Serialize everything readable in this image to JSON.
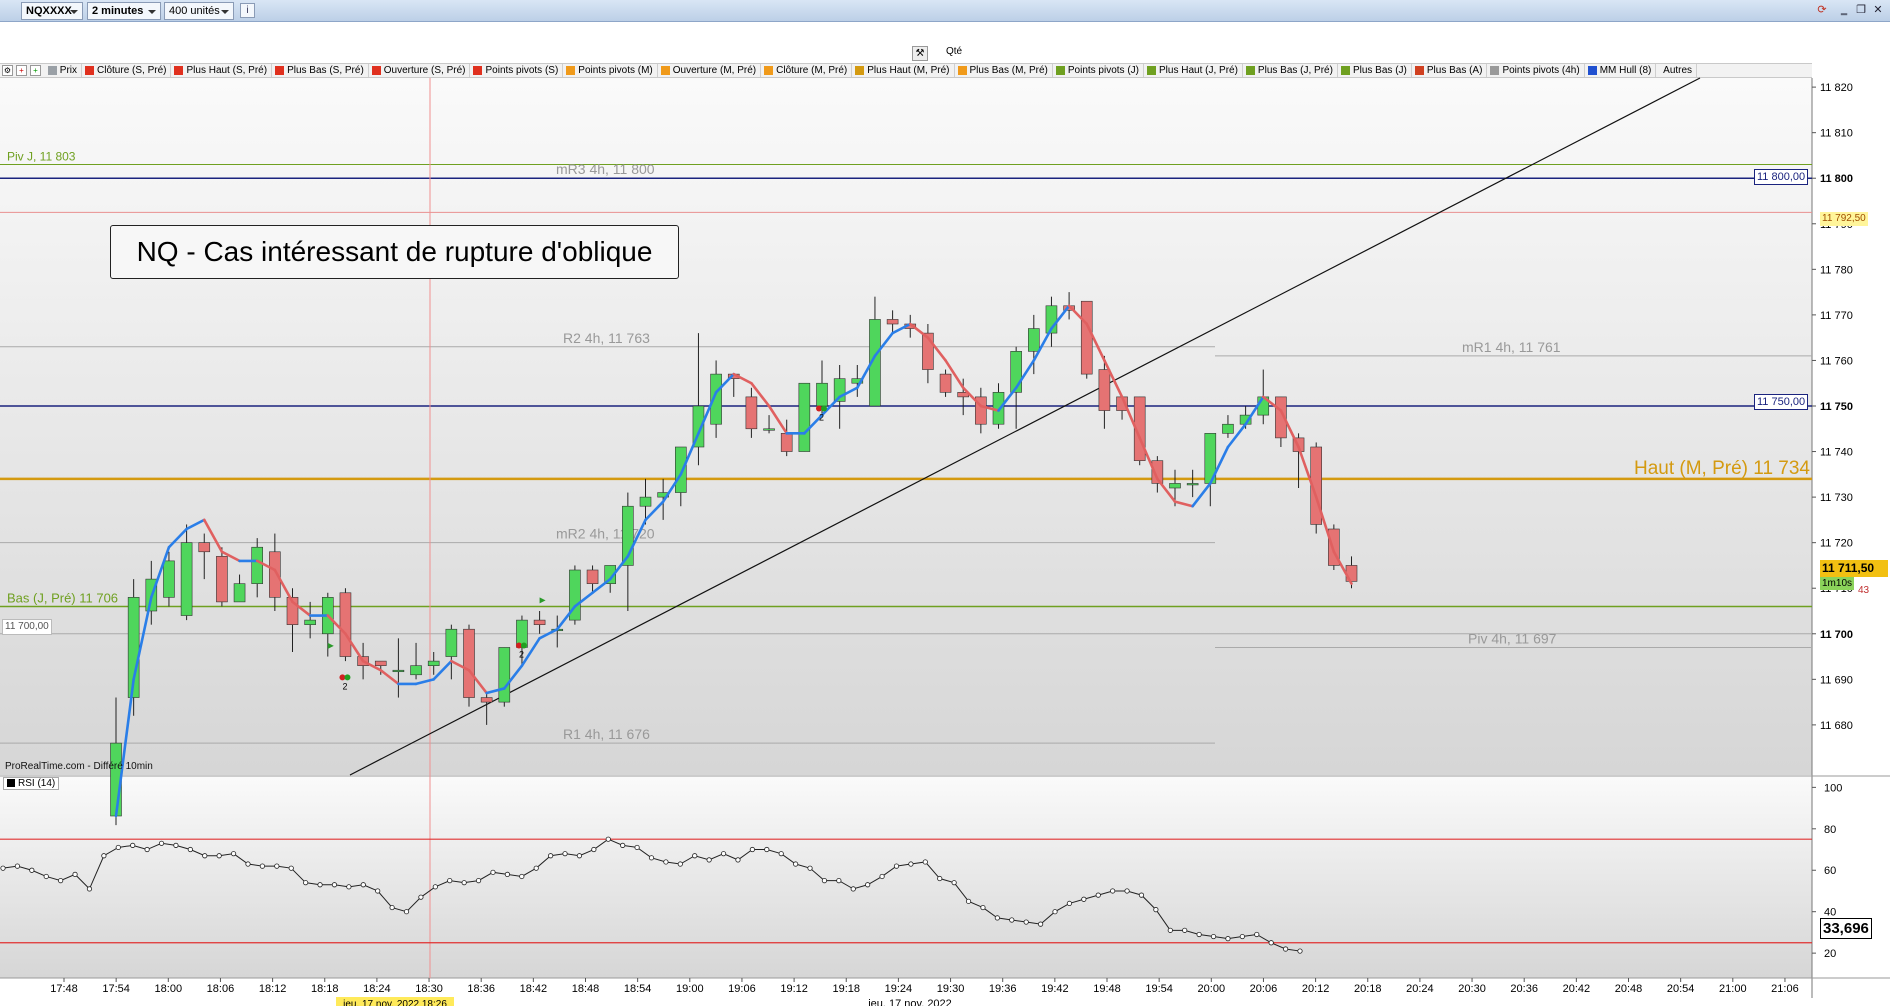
{
  "toolbar": {
    "symbol": "NQXXXX",
    "timeframe": "2 minutes",
    "units": "400 unités",
    "info_label": "i"
  },
  "order": {
    "qty_label": "Qté",
    "qty_value": "1"
  },
  "legend": {
    "items": [
      {
        "label": "Prix",
        "color": "#9aa0a6"
      },
      {
        "label": "Clôture (S, Pré)",
        "color": "#e0301e"
      },
      {
        "label": "Plus Haut (S, Pré)",
        "color": "#e0301e"
      },
      {
        "label": "Plus Bas (S, Pré)",
        "color": "#e0301e"
      },
      {
        "label": "Ouverture (S, Pré)",
        "color": "#e0301e"
      },
      {
        "label": "Points pivots (S)",
        "color": "#e0301e"
      },
      {
        "label": "Points pivots (M)",
        "color": "#f09a1a"
      },
      {
        "label": "Ouverture (M, Pré)",
        "color": "#f09a1a"
      },
      {
        "label": "Clôture (M, Pré)",
        "color": "#f09a1a"
      },
      {
        "label": "Plus Haut (M, Pré)",
        "color": "#d49a10"
      },
      {
        "label": "Plus Bas (M, Pré)",
        "color": "#f09a1a"
      },
      {
        "label": "Points pivots (J)",
        "color": "#6fa020"
      },
      {
        "label": "Plus Haut (J, Pré)",
        "color": "#6fa020"
      },
      {
        "label": "Plus Bas (J, Pré)",
        "color": "#6fa020"
      },
      {
        "label": "Plus Bas (J)",
        "color": "#6fa020"
      },
      {
        "label": "Plus Bas (A)",
        "color": "#d04020"
      },
      {
        "label": "Points pivots (4h)",
        "color": "#9a9a9a"
      },
      {
        "label": "MM Hull (8)",
        "color": "#2050d0"
      }
    ],
    "more_label": "Autres"
  },
  "annotation": {
    "title": "NQ - Cas intéressant de rupture d'oblique"
  },
  "levels": {
    "piv_j": "Piv J, 11 803",
    "mr3": "mR3 4h, 11 800",
    "r2": "R2 4h, 11 763",
    "mr1": "mR1 4h, 11 761",
    "haut_m": "Haut (M, Pré) 11 734",
    "mr2": "mR2 4h, 11 720",
    "bas_j": "Bas (J, Pré) 11 706",
    "piv_4h": "Piv 4h, 11 697",
    "r1": "R1 4h, 11 676"
  },
  "badges": {
    "b11800": "11 800,00",
    "b11792": "11 792,50",
    "b11750": "11 750,00",
    "price": "11 711,50",
    "countdown": "1m10s",
    "b11700": "11 700,00",
    "rsi_value": "33,696",
    "partial": "43"
  },
  "price_axis": [
    "11 820",
    "11 810",
    "11 800",
    "11 790",
    "11 780",
    "11 770",
    "11 760",
    "11 750",
    "11 740",
    "11 730",
    "11 720",
    "11 710",
    "11 700",
    "11 690",
    "11 680"
  ],
  "rsi_axis": [
    "100",
    "80",
    "60",
    "40",
    "20"
  ],
  "time_axis": [
    "17:48",
    "17:54",
    "18:00",
    "18:06",
    "18:12",
    "18:18",
    "18:24",
    "18:30",
    "18:36",
    "18:42",
    "18:48",
    "18:54",
    "19:00",
    "19:06",
    "19:12",
    "19:18",
    "19:24",
    "19:30",
    "19:36",
    "19:42",
    "19:48",
    "19:54",
    "20:00",
    "20:06",
    "20:12",
    "20:18",
    "20:24",
    "20:30",
    "20:36",
    "20:42",
    "20:48",
    "20:54",
    "21:00",
    "21:06"
  ],
  "date_labels": {
    "cursor": "jeu. 17 nov. 2022 18:26",
    "center": "jeu. 17 nov. 2022"
  },
  "attribution": "ProRealTime.com - Différé 10min",
  "rsi_label": "RSI (14)",
  "signal_count": "2",
  "colors": {
    "up": "#4fd65c",
    "down": "#e57373",
    "hull_up": "#2a7ee8",
    "hull_down": "#e06060",
    "level_navy": "#1a237e",
    "level_orange": "#d49a10",
    "level_green": "#6fa020"
  },
  "chart_data": {
    "type": "candlestick",
    "y_range": [
      11669,
      11822
    ],
    "candles": [
      [
        11660,
        11676,
        11658,
        11686
      ],
      [
        11686,
        11708,
        11682,
        11712
      ],
      [
        11705,
        11712,
        11702,
        11716
      ],
      [
        11708,
        11716,
        11706,
        11718
      ],
      [
        11704,
        11720,
        11703,
        11724
      ],
      [
        11720,
        11718,
        11712,
        11722
      ],
      [
        11717,
        11707,
        11706,
        11719
      ],
      [
        11707,
        11711,
        11707,
        11713
      ],
      [
        11711,
        11719,
        11708,
        11721
      ],
      [
        11718,
        11708,
        11705,
        11722
      ],
      [
        11708,
        11702,
        11696,
        11710
      ],
      [
        11702,
        11703,
        11699,
        11707
      ],
      [
        11700,
        11708,
        11695,
        11709
      ],
      [
        11709,
        11695,
        11694,
        11710
      ],
      [
        11695,
        11693,
        11690,
        11698
      ],
      [
        11694,
        11693,
        11691,
        11694
      ],
      [
        11692,
        11692,
        11686,
        11699
      ],
      [
        11691,
        11693,
        11690,
        11698
      ],
      [
        11693,
        11694,
        11691,
        11696
      ],
      [
        11695,
        11701,
        11690,
        11702
      ],
      [
        11701,
        11686,
        11684,
        11702
      ],
      [
        11686,
        11685,
        11680,
        11687
      ],
      [
        11685,
        11697,
        11684,
        11697
      ],
      [
        11697,
        11703,
        11693,
        11704
      ],
      [
        11703,
        11702,
        11700,
        11705
      ],
      [
        11701,
        11701,
        11697,
        11704
      ],
      [
        11703,
        11714,
        11702,
        11715
      ],
      [
        11714,
        11711,
        11709,
        11715
      ],
      [
        11711,
        11715,
        11709,
        11715
      ],
      [
        11715,
        11728,
        11705,
        11731
      ],
      [
        11728,
        11730,
        11724,
        11734
      ],
      [
        11730,
        11731,
        11725,
        11734
      ],
      [
        11731,
        11741,
        11728,
        11741
      ],
      [
        11741,
        11750,
        11737,
        11766
      ],
      [
        11746,
        11757,
        11743,
        11760
      ],
      [
        11757,
        11756,
        11752,
        11757
      ],
      [
        11752,
        11745,
        11743,
        11754
      ],
      [
        11745,
        11745,
        11744,
        11748
      ],
      [
        11744,
        11740,
        11739,
        11747
      ],
      [
        11740,
        11755,
        11740,
        11755
      ],
      [
        11750,
        11755,
        11748,
        11760
      ],
      [
        11751,
        11756,
        11745,
        11759
      ],
      [
        11755,
        11756,
        11752,
        11759
      ],
      [
        11750,
        11769,
        11750,
        11774
      ],
      [
        11769,
        11768,
        11766,
        11771
      ],
      [
        11768,
        11767,
        11765,
        11770
      ],
      [
        11766,
        11758,
        11755,
        11768
      ],
      [
        11757,
        11753,
        11752,
        11758
      ],
      [
        11753,
        11752,
        11748,
        11756
      ],
      [
        11752,
        11746,
        11744,
        11754
      ],
      [
        11746,
        11753,
        11745,
        11755
      ],
      [
        11753,
        11762,
        11745,
        11763
      ],
      [
        11762,
        11767,
        11757,
        11770
      ],
      [
        11766,
        11772,
        11763,
        11774
      ],
      [
        11772,
        11771,
        11769,
        11775
      ],
      [
        11773,
        11757,
        11756,
        11773
      ],
      [
        11758,
        11749,
        11745,
        11761
      ],
      [
        11752,
        11749,
        11747,
        11752
      ],
      [
        11752,
        11738,
        11737,
        11752
      ],
      [
        11738,
        11733,
        11731,
        11739
      ],
      [
        11732,
        11733,
        11728,
        11736
      ],
      [
        11733,
        11733,
        11730,
        11736
      ],
      [
        11733,
        11744,
        11728,
        11744
      ],
      [
        11744,
        11746,
        11743,
        11748
      ],
      [
        11746,
        11748,
        11745,
        11750
      ],
      [
        11748,
        11752,
        11746,
        11758
      ],
      [
        11752,
        11743,
        11741,
        11752
      ],
      [
        11743,
        11740,
        11732,
        11744
      ],
      [
        11741,
        11724,
        11722,
        11742
      ],
      [
        11723,
        11715,
        11714,
        11724
      ],
      [
        11715,
        11711.5,
        11710,
        11717
      ]
    ],
    "hull": [
      [
        0,
        11660
      ],
      [
        1,
        11690
      ],
      [
        2,
        11708
      ],
      [
        3,
        11719
      ],
      [
        4,
        11723
      ],
      [
        5,
        11725
      ],
      [
        6,
        11718
      ],
      [
        7,
        11716
      ],
      [
        8,
        11716
      ],
      [
        9,
        11714
      ],
      [
        10,
        11707
      ],
      [
        11,
        11704
      ],
      [
        12,
        11704
      ],
      [
        13,
        11700
      ],
      [
        14,
        11694
      ],
      [
        15,
        11692
      ],
      [
        16,
        11689
      ],
      [
        17,
        11689
      ],
      [
        18,
        11690
      ],
      [
        19,
        11694
      ],
      [
        20,
        11692
      ],
      [
        21,
        11687
      ],
      [
        22,
        11688
      ],
      [
        23,
        11693
      ],
      [
        24,
        11699
      ],
      [
        25,
        11701
      ],
      [
        26,
        11706
      ],
      [
        27,
        11709
      ],
      [
        28,
        11712
      ],
      [
        29,
        11717
      ],
      [
        30,
        11725
      ],
      [
        31,
        11729
      ],
      [
        32,
        11735
      ],
      [
        33,
        11744
      ],
      [
        34,
        11753
      ],
      [
        35,
        11757
      ],
      [
        36,
        11755
      ],
      [
        37,
        11750
      ],
      [
        38,
        11744
      ],
      [
        39,
        11744
      ],
      [
        40,
        11748
      ],
      [
        41,
        11752
      ],
      [
        42,
        11754
      ],
      [
        43,
        11761
      ],
      [
        44,
        11766
      ],
      [
        45,
        11768
      ],
      [
        46,
        11765
      ],
      [
        47,
        11760
      ],
      [
        48,
        11754
      ],
      [
        49,
        11750
      ],
      [
        50,
        11749
      ],
      [
        51,
        11754
      ],
      [
        52,
        11760
      ],
      [
        53,
        11767
      ],
      [
        54,
        11772
      ],
      [
        55,
        11768
      ],
      [
        56,
        11760
      ],
      [
        57,
        11752
      ],
      [
        58,
        11743
      ],
      [
        59,
        11734
      ],
      [
        60,
        11729
      ],
      [
        61,
        11728
      ],
      [
        62,
        11733
      ],
      [
        63,
        11741
      ],
      [
        64,
        11746
      ],
      [
        65,
        11752
      ],
      [
        66,
        11749
      ],
      [
        67,
        11741
      ],
      [
        68,
        11730
      ],
      [
        69,
        11718
      ],
      [
        70,
        11711
      ]
    ],
    "rsi": [
      61,
      62,
      60,
      57,
      55,
      58,
      51,
      67,
      71,
      72,
      70,
      73,
      72,
      70,
      67,
      67,
      68,
      63,
      62,
      62,
      61,
      54,
      53,
      53,
      52,
      53,
      50,
      42,
      40,
      47,
      52,
      55,
      54,
      55,
      59,
      58,
      57,
      61,
      67,
      68,
      67,
      70,
      75,
      72,
      71,
      66,
      64,
      63,
      67,
      65,
      68,
      65,
      70,
      70,
      68,
      63,
      61,
      55,
      55,
      51,
      53,
      57,
      62,
      63,
      64,
      56,
      54,
      45,
      42,
      37,
      36,
      35,
      34,
      40,
      44,
      46,
      48,
      50,
      50,
      48,
      41,
      31,
      31,
      29,
      28,
      27,
      28,
      29,
      25,
      22,
      21
    ],
    "rsi_range": [
      8,
      105
    ],
    "rsi_bands": [
      75,
      25
    ]
  }
}
